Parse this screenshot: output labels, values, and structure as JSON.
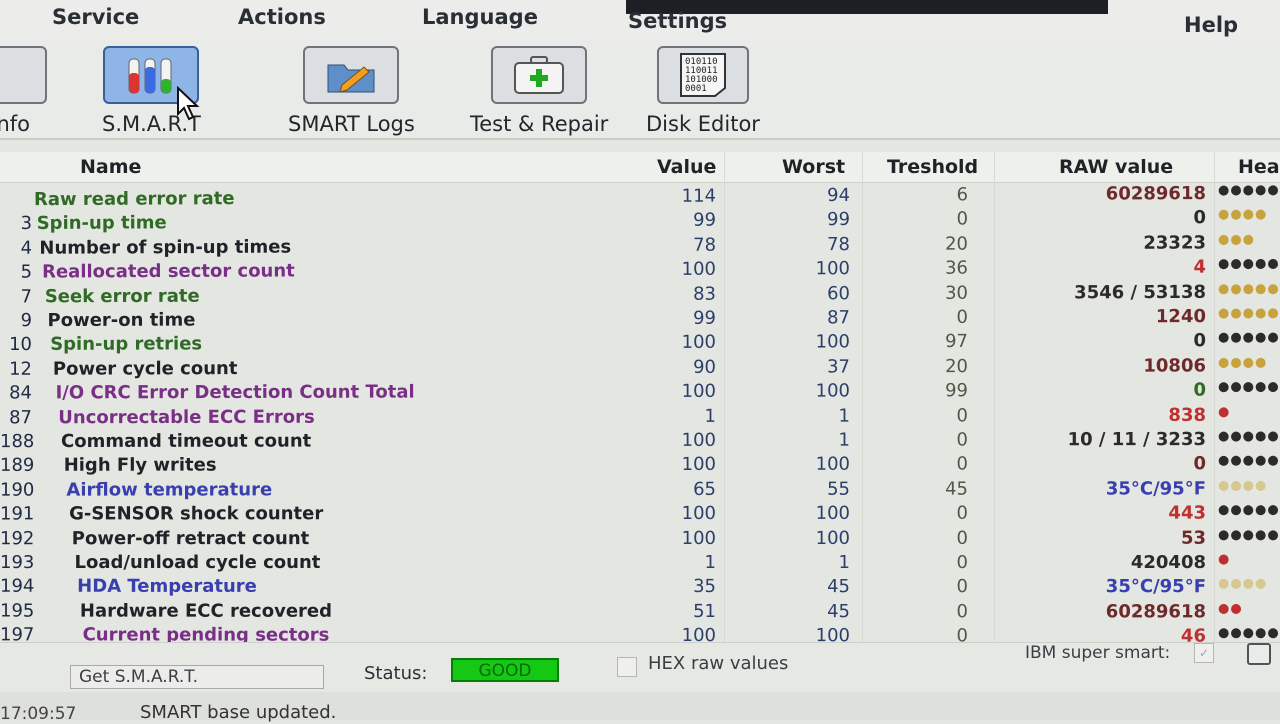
{
  "menu": {
    "items": [
      {
        "label": "Service"
      },
      {
        "label": "Actions"
      },
      {
        "label": "Language"
      },
      {
        "label": "Settings"
      },
      {
        "label": "Help"
      }
    ]
  },
  "toolbar": {
    "tools": [
      {
        "label": "nfo",
        "icon": "info-icon"
      },
      {
        "label": "S.M.A.R.T",
        "icon": "smart-tubes-icon",
        "active": true
      },
      {
        "label": "SMART Logs",
        "icon": "folder-pen-icon"
      },
      {
        "label": "Test & Repair",
        "icon": "first-aid-kit-icon"
      },
      {
        "label": "Disk Editor",
        "icon": "binary-document-icon"
      }
    ]
  },
  "table": {
    "columns": {
      "name": "Name",
      "value": "Value",
      "worst": "Worst",
      "threshold": "Treshold",
      "raw": "RAW value",
      "health": "Hea"
    },
    "rows": [
      {
        "id": "",
        "name": "Raw read error rate",
        "value": "114",
        "worst": "94",
        "threshold": "6",
        "raw": "60289618",
        "health": 5,
        "name_color": "#2f6b24",
        "raw_color": "#6e2a2a",
        "dot_color": "#2b2b2b"
      },
      {
        "id": "3",
        "name": "Spin-up time",
        "value": "99",
        "worst": "99",
        "threshold": "0",
        "raw": "0",
        "health": 4,
        "name_color": "#2f6b24",
        "raw_color": "#2b2b2b",
        "dot_color": "#c8a23c"
      },
      {
        "id": "4",
        "name": "Number of spin-up times",
        "value": "78",
        "worst": "78",
        "threshold": "20",
        "raw": "23323",
        "health": 3,
        "name_color": "#1f2327",
        "raw_color": "#2b2b2b",
        "dot_color": "#c8a23c"
      },
      {
        "id": "5",
        "name": "Reallocated sector count",
        "value": "100",
        "worst": "100",
        "threshold": "36",
        "raw": "4",
        "health": 6,
        "name_color": "#7a2f86",
        "raw_color": "#c03030",
        "dot_color": "#2b2b2b"
      },
      {
        "id": "7",
        "name": "Seek error rate",
        "value": "83",
        "worst": "60",
        "threshold": "30",
        "raw": "3546 / 53138",
        "health": 5,
        "name_color": "#2f6b24",
        "raw_color": "#2b2b2b",
        "dot_color": "#c8a23c"
      },
      {
        "id": "9",
        "name": "Power-on time",
        "value": "99",
        "worst": "87",
        "threshold": "0",
        "raw": "1240",
        "health": 5,
        "name_color": "#1f2327",
        "raw_color": "#6e2a2a",
        "dot_color": "#c8a23c"
      },
      {
        "id": "10",
        "name": "Spin-up retries",
        "value": "100",
        "worst": "100",
        "threshold": "97",
        "raw": "0",
        "health": 5,
        "name_color": "#2f6b24",
        "raw_color": "#2b2b2b",
        "dot_color": "#2b2b2b"
      },
      {
        "id": "12",
        "name": "Power cycle count",
        "value": "90",
        "worst": "37",
        "threshold": "20",
        "raw": "10806",
        "health": 4,
        "name_color": "#1f2327",
        "raw_color": "#6e2a2a",
        "dot_color": "#c8a23c"
      },
      {
        "id": "84",
        "name": "I/O CRC Error Detection Count Total",
        "value": "100",
        "worst": "100",
        "threshold": "99",
        "raw": "0",
        "health": 6,
        "name_color": "#7a2f86",
        "raw_color": "#2f6b24",
        "dot_color": "#2b2b2b"
      },
      {
        "id": "87",
        "name": "Uncorrectable ECC Errors",
        "value": "1",
        "worst": "1",
        "threshold": "0",
        "raw": "838",
        "health": 1,
        "name_color": "#7a2f86",
        "raw_color": "#c03030",
        "dot_color": "#c03030"
      },
      {
        "id": "188",
        "name": "Command timeout count",
        "value": "100",
        "worst": "1",
        "threshold": "0",
        "raw": "10 / 11 / 3233",
        "health": 5,
        "name_color": "#1f2327",
        "raw_color": "#2b2b2b",
        "dot_color": "#2b2b2b"
      },
      {
        "id": "189",
        "name": "High Fly writes",
        "value": "100",
        "worst": "100",
        "threshold": "0",
        "raw": "0",
        "health": 6,
        "name_color": "#1f2327",
        "raw_color": "#6e2a2a",
        "dot_color": "#2b2b2b"
      },
      {
        "id": "190",
        "name": "Airflow temperature",
        "value": "65",
        "worst": "55",
        "threshold": "45",
        "raw": "35°C/95°F",
        "health": 4,
        "name_color": "#3a3fb0",
        "raw_color": "#3a3fb0",
        "dot_color": "#d8c890"
      },
      {
        "id": "191",
        "name": "G-SENSOR shock counter",
        "value": "100",
        "worst": "100",
        "threshold": "0",
        "raw": "443",
        "health": 5,
        "name_color": "#1f2327",
        "raw_color": "#c03030",
        "dot_color": "#2b2b2b"
      },
      {
        "id": "192",
        "name": "Power-off retract count",
        "value": "100",
        "worst": "100",
        "threshold": "0",
        "raw": "53",
        "health": 5,
        "name_color": "#1f2327",
        "raw_color": "#6e2a2a",
        "dot_color": "#2b2b2b"
      },
      {
        "id": "193",
        "name": "Load/unload cycle count",
        "value": "1",
        "worst": "1",
        "threshold": "0",
        "raw": "420408",
        "health": 1,
        "name_color": "#1f2327",
        "raw_color": "#2b2b2b",
        "dot_color": "#c03030"
      },
      {
        "id": "194",
        "name": "HDA Temperature",
        "value": "35",
        "worst": "45",
        "threshold": "0",
        "raw": "35°C/95°F",
        "health": 4,
        "name_color": "#3a3fb0",
        "raw_color": "#3a3fb0",
        "dot_color": "#d8c890"
      },
      {
        "id": "195",
        "name": "Hardware ECC recovered",
        "value": "51",
        "worst": "45",
        "threshold": "0",
        "raw": "60289618",
        "health": 2,
        "name_color": "#1f2327",
        "raw_color": "#6e2a2a",
        "dot_color": "#c03030"
      },
      {
        "id": "197",
        "name": "Current pending sectors",
        "value": "100",
        "worst": "100",
        "threshold": "0",
        "raw": "46",
        "health": 5,
        "name_color": "#7a2f86",
        "raw_color": "#c03030",
        "dot_color": "#2b2b2b"
      }
    ]
  },
  "footer": {
    "get_button": "Get S.M.A.R.T.",
    "status_label": "Status:",
    "status_value": "GOOD",
    "hex_label": "HEX raw values",
    "ibm_label": "IBM super smart:"
  },
  "statusbar": {
    "time": "17:09:57",
    "message": "SMART base updated."
  }
}
